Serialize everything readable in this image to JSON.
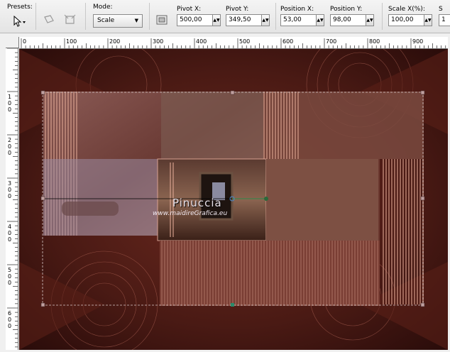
{
  "toolbar": {
    "presets_label": "Presets:",
    "mode_label": "Mode:",
    "mode_value": "Scale",
    "pivot_x_label": "Pivot X:",
    "pivot_x_value": "500,00",
    "pivot_y_label": "Pivot Y:",
    "pivot_y_value": "349,50",
    "position_x_label": "Position X:",
    "position_x_value": "53,00",
    "position_y_label": "Position Y:",
    "position_y_value": "98,00",
    "scale_x_label": "Scale X(%):",
    "scale_x_value": "100,00",
    "scale_y_label_partial": "S",
    "scale_y_value_partial": "1"
  },
  "ruler": {
    "top_ticks": [
      "0",
      "100",
      "200",
      "300",
      "400",
      "500",
      "600",
      "700",
      "800",
      "900"
    ],
    "left_ticks": [
      "1\n0\n0",
      "2\n0\n0",
      "3\n0\n0",
      "4\n0\n0",
      "5\n0\n0",
      "6\n0\n0"
    ]
  },
  "canvas": {
    "watermark_name": "Pinuccia",
    "watermark_url": "www.maidireGrafica.eu"
  },
  "colors": {
    "dark_brown": "#3a1410",
    "rust": "#8a3c2c",
    "salmon": "#d89a86",
    "handle": "#c0a0a0"
  }
}
